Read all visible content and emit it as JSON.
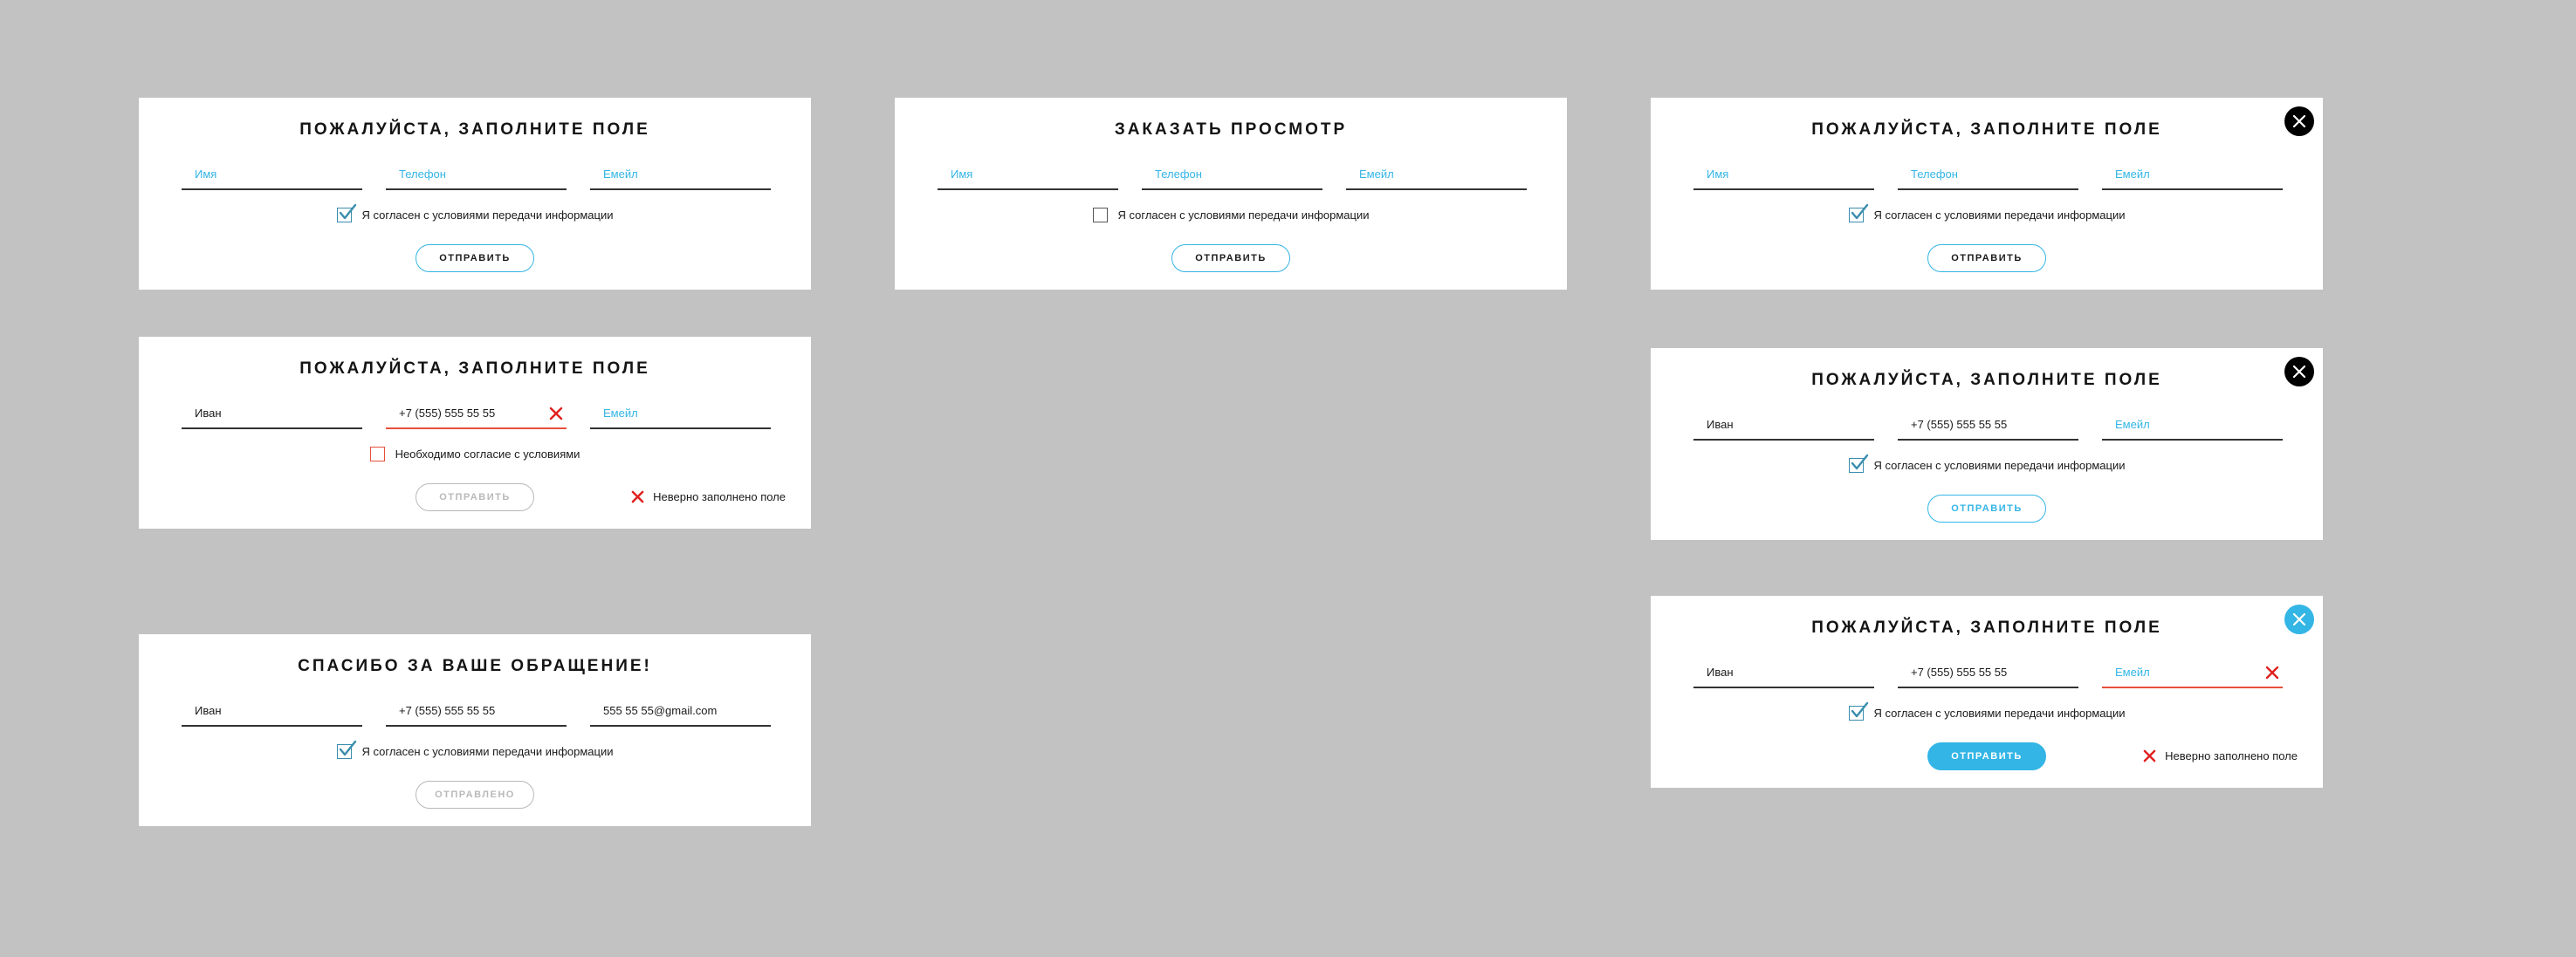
{
  "cards": {
    "c1": {
      "title": "ПОЖАЛУЙСТА, ЗАПОЛНИТЕ ПОЛЕ",
      "name_placeholder": "Имя",
      "phone_placeholder": "Телефон",
      "email_placeholder": "Емейл",
      "consent": "Я согласен с  условиями передачи информации",
      "button": "ОТПРАВИТЬ"
    },
    "c2": {
      "title": "ЗАКАЗАТЬ ПРОСМОТР",
      "name_placeholder": "Имя",
      "phone_placeholder": "Телефон",
      "email_placeholder": "Емейл",
      "consent": "Я согласен с  условиями передачи информации",
      "button": "ОТПРАВИТЬ"
    },
    "c3": {
      "title": "ПОЖАЛУЙСТА, ЗАПОЛНИТЕ ПОЛЕ",
      "name_placeholder": "Имя",
      "phone_placeholder": "Телефон",
      "email_placeholder": "Емейл",
      "consent": "Я согласен с  условиями передачи информации",
      "button": "ОТПРАВИТЬ"
    },
    "c4": {
      "title": "ПОЖАЛУЙСТА, ЗАПОЛНИТЕ ПОЛЕ",
      "name_value": "Иван",
      "phone_value": "+7 (555) 555 55 55",
      "email_placeholder": "Емейл",
      "consent": "Необходимо согласие с условиями",
      "button": "ОТПРАВИТЬ",
      "error": "Неверно заполнено поле"
    },
    "c5": {
      "title": "ПОЖАЛУЙСТА, ЗАПОЛНИТЕ ПОЛЕ",
      "name_value": "Иван",
      "phone_value": "+7 (555) 555 55 55",
      "email_placeholder": "Емейл",
      "consent": "Я согласен с  условиями передачи информации",
      "button": "ОТПРАВИТЬ"
    },
    "c6": {
      "title": "СПАСИБО ЗА ВАШЕ ОБРАЩЕНИЕ!",
      "name_value": "Иван",
      "phone_value": "+7 (555) 555 55 55",
      "email_value": "555 55 55@gmail.com",
      "consent": "Я согласен с  условиями передачи информации",
      "button": "ОТПРАВЛЕНО"
    },
    "c7": {
      "title": "ПОЖАЛУЙСТА, ЗАПОЛНИТЕ ПОЛЕ",
      "name_value": "Иван",
      "phone_value": "+7 (555) 555 55 55",
      "email_placeholder": "Емейл",
      "consent": "Я согласен с  условиями передачи информации",
      "button": "ОТПРАВИТЬ",
      "error": "Неверно заполнено поле"
    }
  },
  "colors": {
    "background": "#c2c2c2",
    "accent": "#33b5e5",
    "error": "#e8503c",
    "checkbox_border": "#3a8dae"
  },
  "icons": [
    "checkmark-icon",
    "error-x-icon",
    "close-icon"
  ]
}
